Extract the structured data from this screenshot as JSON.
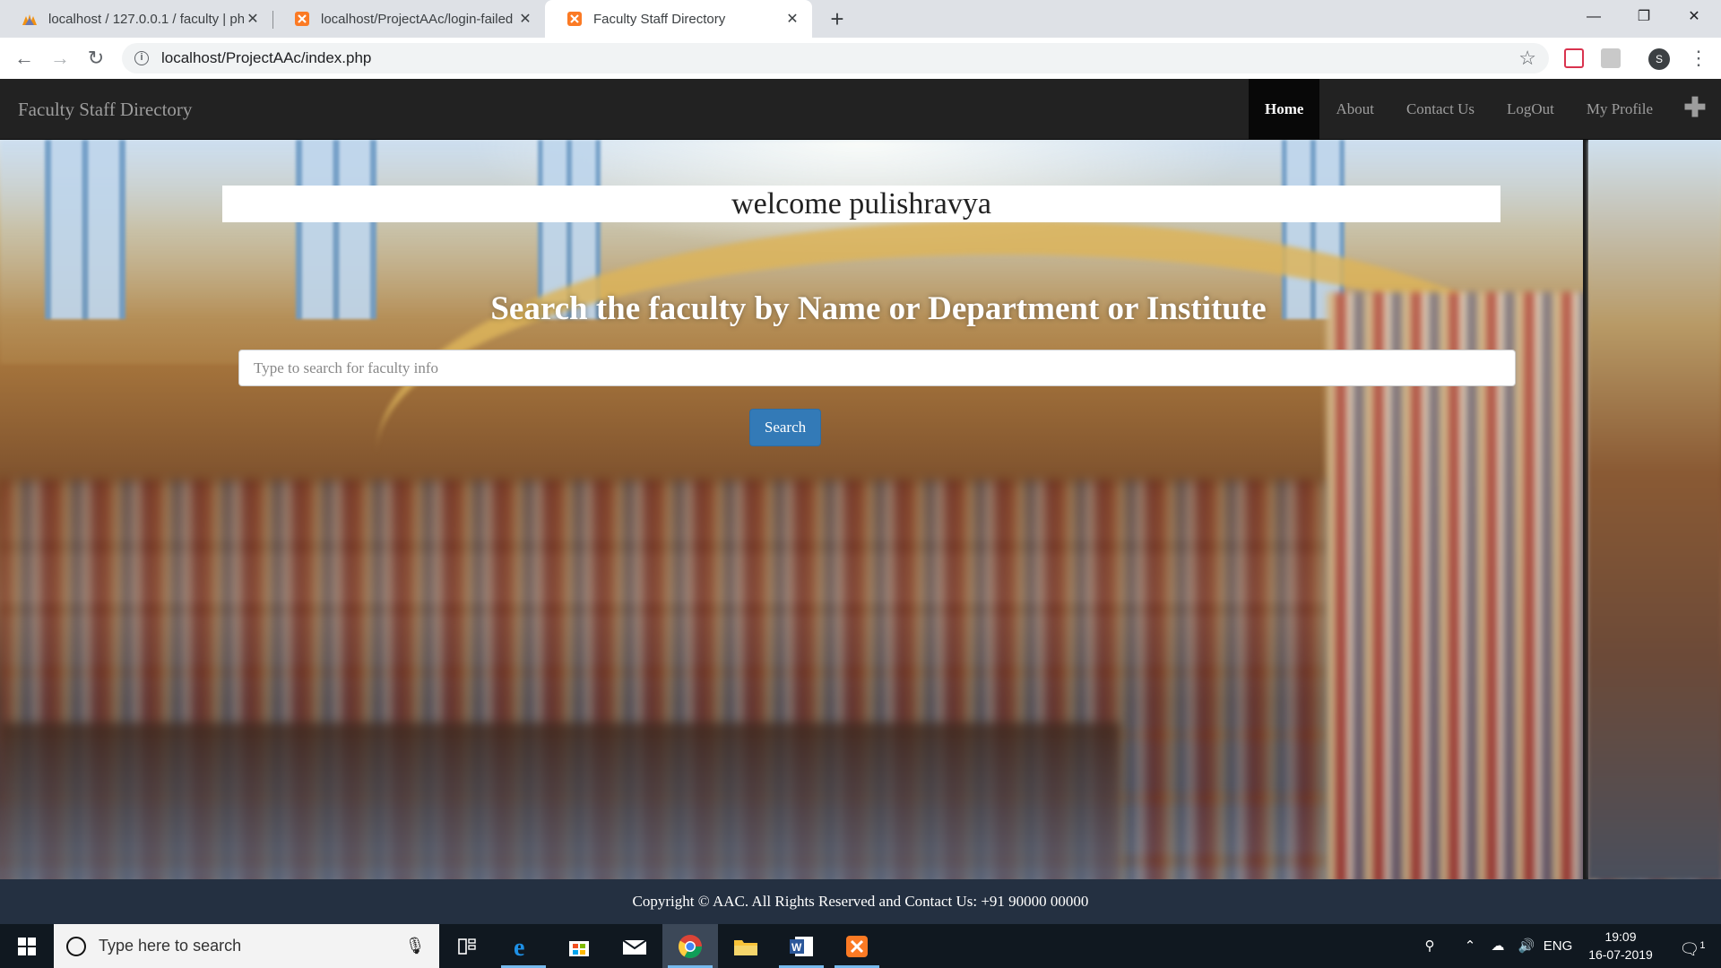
{
  "browser": {
    "tabs": [
      {
        "title": "localhost / 127.0.0.1 / faculty | phpMyAdmin",
        "active": false
      },
      {
        "title": "localhost/ProjectAAc/login-failed",
        "active": false
      },
      {
        "title": "Faculty Staff Directory",
        "active": true
      }
    ],
    "url": "localhost/ProjectAAc/index.php",
    "profile_initial": "S"
  },
  "page": {
    "brand": "Faculty Staff Directory",
    "nav": [
      {
        "label": "Home",
        "active": true
      },
      {
        "label": "About",
        "active": false
      },
      {
        "label": "Contact Us",
        "active": false
      },
      {
        "label": "LogOut",
        "active": false
      },
      {
        "label": "My Profile",
        "active": false
      }
    ],
    "welcome": "welcome pulishravya",
    "heading": "Search the faculty by Name or Department or Institute",
    "search_placeholder": "Type to search for faculty info",
    "search_value": "",
    "search_button": "Search",
    "footer": "Copyright © AAC. All Rights Reserved and Contact Us: +91 90000 00000"
  },
  "taskbar": {
    "search_placeholder": "Type here to search",
    "language": "ENG",
    "time": "19:09",
    "date": "16-07-2019",
    "notification_count": "1",
    "apps": [
      "task-view",
      "edge",
      "store",
      "mail",
      "chrome",
      "file-explorer",
      "word",
      "xampp"
    ]
  },
  "colors": {
    "navbar_bg": "#222222",
    "nav_active_bg": "#080808",
    "button_primary": "#337ab7",
    "footer_bg": "#243041",
    "taskbar_bg": "#101820"
  }
}
